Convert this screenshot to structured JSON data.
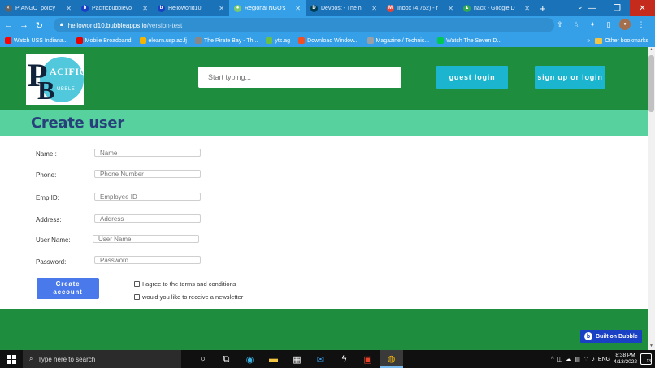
{
  "browser": {
    "tabs": [
      {
        "title": "PIANGO_policy_",
        "icon": "globe-icon",
        "color": "#e8eaed"
      },
      {
        "title": "Pacificbubblevo",
        "icon": "bubble-icon",
        "color": "#1a40c4"
      },
      {
        "title": "Helloworld10",
        "icon": "bubble-icon",
        "color": "#1a40c4"
      },
      {
        "title": "Regional NGO's",
        "icon": "globe-icon",
        "color": "#7bc96f"
      },
      {
        "title": "Devpost - The h",
        "icon": "devpost-icon",
        "color": "#003e54"
      },
      {
        "title": "Inbox (4,762) - r",
        "icon": "gmail-icon",
        "color": "#ea4335"
      },
      {
        "title": "hack - Google D",
        "icon": "drive-icon",
        "color": "#34a853"
      }
    ],
    "active_tab_index": 3,
    "url_host": "helloworld10.bubbleapps.io",
    "url_path": "/version-test",
    "bookmarks": [
      {
        "label": "Watch USS Indiana...",
        "color": "#ff0000"
      },
      {
        "label": "Mobile Broadband",
        "color": "#e60000"
      },
      {
        "label": "elearn.usp.ac.fj",
        "color": "#f4b400"
      },
      {
        "label": "The Pirate Bay - Th...",
        "color": "#888888"
      },
      {
        "label": "yts.ag",
        "color": "#6ac045"
      },
      {
        "label": "Download Window...",
        "color": "#f25022"
      },
      {
        "label": "Magazine / Technic...",
        "color": "#9aa0a6"
      },
      {
        "label": "Watch The Seven D...",
        "color": "#00c853"
      }
    ],
    "bookmarks_more": "»",
    "other_bookmarks": "Other bookmarks"
  },
  "app": {
    "logo": {
      "big1": "P",
      "big2": "B",
      "word1": "ACIFIC",
      "word2": "UBBLE"
    },
    "search_placeholder": "Start typing...",
    "guest_login": "guest login",
    "signup_login": "sign up or login",
    "page_title": "Create user",
    "form": {
      "fields": [
        {
          "label": "Name :",
          "placeholder": "Name"
        },
        {
          "label": "Phone:",
          "placeholder": "Phone Number"
        },
        {
          "label": "Emp ID:",
          "placeholder": "Employee ID"
        },
        {
          "label": "Address:",
          "placeholder": "Address"
        },
        {
          "label": "User Name:",
          "placeholder": "User Name"
        },
        {
          "label": "Password:",
          "placeholder": "Password"
        }
      ],
      "create_button_line1": "Create",
      "create_button_line2": "account",
      "terms_label": "I agree to the terms and conditions",
      "newsletter_label": "would you like to receive a newsletter"
    },
    "built_on": "Built on Bubble"
  },
  "taskbar": {
    "search_placeholder": "Type here to search",
    "language": "ENG",
    "time": "8:38 PM",
    "date": "4/13/2022",
    "notifications": "13"
  }
}
